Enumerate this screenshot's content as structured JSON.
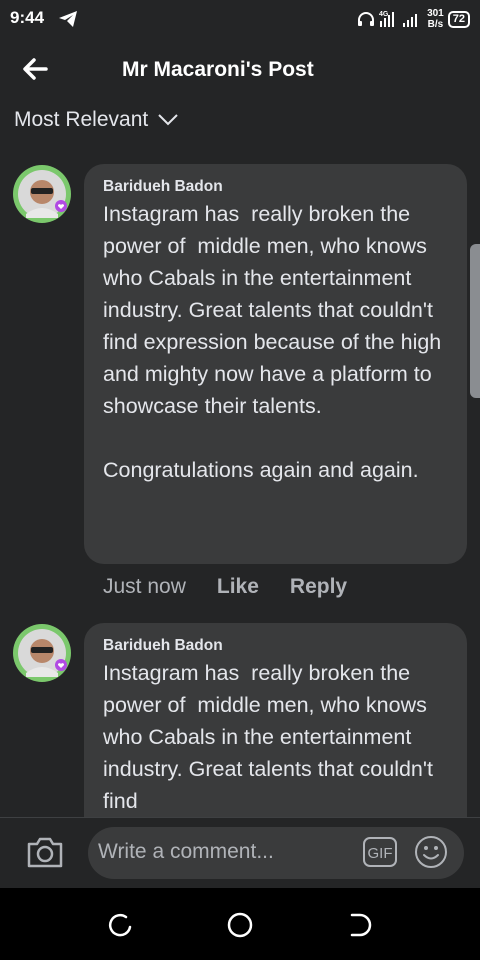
{
  "status_bar": {
    "time": "9:44",
    "network_label": "4G",
    "speed_value": "301",
    "speed_unit": "B/s",
    "battery": "72",
    "icons": [
      "telegram-icon",
      "headphones-icon",
      "signal-icon",
      "battery-icon"
    ]
  },
  "header": {
    "title": "Mr Macaroni's Post",
    "back_icon": "back-arrow-icon"
  },
  "sort": {
    "label": "Most Relevant",
    "icon": "chevron-down-icon"
  },
  "comments": [
    {
      "author": "Baridueh Badon",
      "text": "Instagram has  really broken the power of  middle men, who knows who Cabals in the entertainment industry. Great talents that couldn't find expression because of the high and mighty now have a platform to showcase their talents.\n\nCongratulations again and again.",
      "time": "Just now",
      "like_label": "Like",
      "reply_label": "Reply"
    },
    {
      "author": "Baridueh Badon",
      "text": "Instagram has  really broken the power of  middle men, who knows who Cabals in the entertainment industry. Great talents that couldn't find"
    }
  ],
  "composer": {
    "placeholder": "Write a comment...",
    "gif_label": "GIF",
    "icons": [
      "camera-icon",
      "gif-icon",
      "emoji-icon"
    ]
  },
  "nav_bar": {
    "icons": [
      "recents-icon",
      "home-icon",
      "back-icon"
    ]
  },
  "colors": {
    "background": "#242526",
    "bubble": "#3a3b3c",
    "text_primary": "#e4e6eb",
    "text_secondary": "#b0b3b8",
    "nav_bar": "#000000"
  }
}
